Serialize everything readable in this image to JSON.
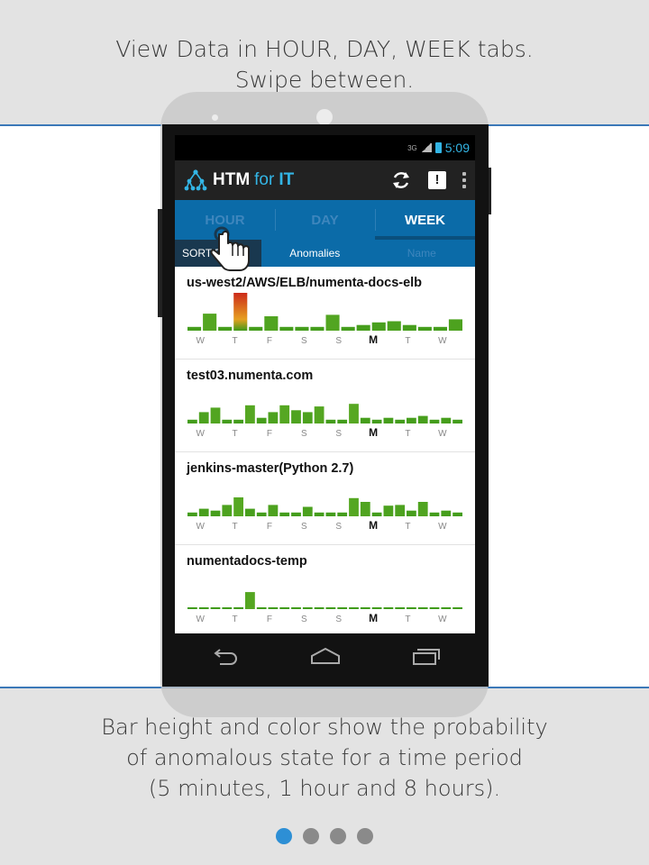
{
  "caption_top": [
    "View Data in HOUR, DAY, WEEK tabs.",
    "Swipe between."
  ],
  "caption_bottom": [
    "Bar height and color show the  probability",
    "of anomalous state for a time period",
    "(5 minutes, 1 hour and 8 hours)."
  ],
  "status_bar": {
    "network": "3G",
    "time": "5:09"
  },
  "app": {
    "title_main": "HTM",
    "title_for": "for",
    "title_it": "IT"
  },
  "action_icons": [
    "refresh-icon",
    "alert-icon",
    "overflow-menu-icon"
  ],
  "alert_label": "!",
  "tabs": [
    {
      "label": "HOUR",
      "active": false
    },
    {
      "label": "DAY",
      "active": false
    },
    {
      "label": "WEEK",
      "active": true
    }
  ],
  "sort": {
    "label": "SORT BY",
    "options": [
      "Anomalies",
      "Name"
    ],
    "selected": "Anomalies"
  },
  "day_labels": [
    "W",
    "T",
    "F",
    "S",
    "S",
    "M",
    "T",
    "W"
  ],
  "today_index": 5,
  "instances": [
    {
      "name": "us-west2/AWS/ELB/numenta-docs-elb",
      "bars": [
        0.1,
        0.45,
        0.1,
        1.0,
        0.1,
        0.38,
        0.1,
        0.1,
        0.1,
        0.42,
        0.1,
        0.15,
        0.22,
        0.25,
        0.15,
        0.1,
        0.1,
        0.3
      ]
    },
    {
      "name": "test03.numenta.com",
      "bars": [
        0.1,
        0.3,
        0.42,
        0.1,
        0.1,
        0.48,
        0.15,
        0.3,
        0.48,
        0.35,
        0.3,
        0.45,
        0.1,
        0.1,
        0.52,
        0.15,
        0.1,
        0.15,
        0.1,
        0.15,
        0.2,
        0.1,
        0.15,
        0.1
      ]
    },
    {
      "name": "jenkins-master(Python 2.7)",
      "bars": [
        0.1,
        0.2,
        0.15,
        0.3,
        0.5,
        0.2,
        0.1,
        0.3,
        0.1,
        0.1,
        0.25,
        0.1,
        0.1,
        0.1,
        0.48,
        0.38,
        0.1,
        0.28,
        0.3,
        0.15,
        0.38,
        0.1,
        0.15,
        0.1
      ]
    },
    {
      "name": "numentadocs-temp",
      "bars": [
        0.02,
        0.02,
        0.02,
        0.02,
        0.05,
        0.45,
        0.02,
        0.02,
        0.02,
        0.02,
        0.02,
        0.02,
        0.02,
        0.02,
        0.02,
        0.02,
        0.02,
        0.02,
        0.02,
        0.02,
        0.02,
        0.02,
        0.02,
        0.02
      ]
    }
  ],
  "nav_buttons": [
    "back-icon",
    "home-icon",
    "recents-icon"
  ],
  "pager": {
    "count": 4,
    "active": 0
  },
  "colors": {
    "accent": "#33b5e5",
    "tab_bar": "#0b6ba8",
    "bar_green": "#3f9a1a",
    "bar_red": "#cc2a1a",
    "divider_blue": "#3b78b8"
  }
}
